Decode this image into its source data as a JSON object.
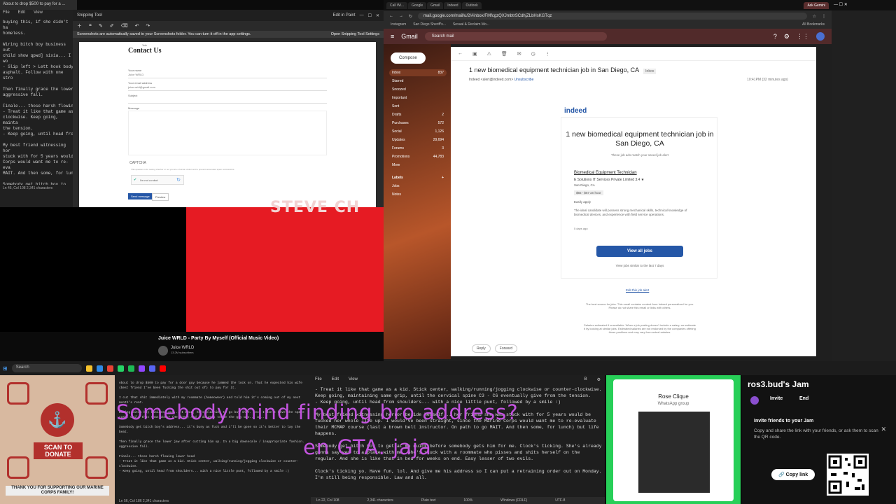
{
  "left_notepad": {
    "title": "About to drop $500 to pay for a ...",
    "menu": [
      "File",
      "Edit",
      "View"
    ],
    "text": "buying this, if she didn't ha\nhomeless.\n\nWiring bitch boy business out\nchild show qpwd] sixia... I wo\n- Slip left > Lett hook body\nasphalt. Follow with one stro\n\nThen finally grace the lower\naggressive fall.\n\nFinale... those harsh flowin\n- Treat it like that game as\nclockwise. Keep going, mainta\nthe tension.\n- Keep going, until head fro\n\nMy best friend witnessing hor\nstuck with for 5 years would\nCorps would want me to re-eva\nMAIT. And then some, for lun\n\nSomebody get bitch boy to let\nShe's already gonna say yes t\nherself on the regular. And s\n\nClock's ticking yo. Have fun\nMonday. I'm still being respo",
    "status": "Ln 45, Col 108    2,341 characters"
  },
  "snip": {
    "title": "Snipping Tool",
    "notif": "Screenshots are automatically saved to your Screenshots folder. You can turn it off in the app settings.",
    "notif_link": "Open Snipping Tool Settings",
    "edit_in_paint": "Edit in Paint",
    "form": {
      "heading": "Contact Us",
      "small_top": "Yob",
      "name_label": "Your name",
      "name_value": "Juice WRLD",
      "email_label": "Your email address",
      "email_value": "juice.wrld@gmail.com",
      "subject_label": "Subject",
      "message_label": "Message",
      "captcha": "CAPTCHA",
      "captcha_text": "This question is for testing whether or not you are a human visitor and to prevent automated spam submissions.",
      "robot": "I'm not a robot",
      "send": "Send message",
      "preview": "Preview"
    }
  },
  "video": {
    "overlay_text": "STEVE CH",
    "title": "Juice WRLD - Party By Myself (Official Music Video)",
    "channel": "Juice WRLD",
    "subs": "13.2M subscribers"
  },
  "chrome": {
    "tabs": [
      "Call Wi...",
      "Google",
      "Gmail",
      "Indeed",
      "Outlook",
      "Ask Gemini"
    ],
    "url": "mail.google.com/mail/u/2/#inbox/FMfcgzQXJmbtrSCdhjZLbHsKGTqz",
    "bookmarks": [
      "Instagram",
      "San Diego Sheriff's...",
      "Sexual & Reclaim Mo..."
    ],
    "all_bookmarks": "All Bookmarks"
  },
  "gmail": {
    "logo": "Gmail",
    "search": "Search mail",
    "compose": "Compose",
    "nav": [
      {
        "label": "Inbox",
        "count": "837"
      },
      {
        "label": "Starred",
        "count": ""
      },
      {
        "label": "Snoozed",
        "count": ""
      },
      {
        "label": "Important",
        "count": ""
      },
      {
        "label": "Sent",
        "count": ""
      },
      {
        "label": "Drafts",
        "count": "2"
      },
      {
        "label": "Purchases",
        "count": "572"
      },
      {
        "label": "Social",
        "count": "1,126"
      },
      {
        "label": "Updates",
        "count": "29,694"
      },
      {
        "label": "Forums",
        "count": "3"
      },
      {
        "label": "Promotions",
        "count": "44,783"
      },
      {
        "label": "More",
        "count": ""
      }
    ],
    "labels_title": "Labels",
    "labels": [
      "Jobs",
      "Notes"
    ],
    "subject": "1 new biomedical equipment technician job in San Diego, CA",
    "inbox_tag": "Inbox",
    "sender": "Indeed <alert@indeed.com>",
    "unsubscribe": "Unsubscribe",
    "time": "10:41PM (32 minutes ago)",
    "email": {
      "brand": "indeed",
      "heading": "1 new biomedical equipment technician job in San Diego, CA",
      "sub": "These job ads match your saved job alert",
      "job_title": "Biomedical Equipment Technician",
      "company": "E Solutions IT Services Private Limited",
      "rating": "3.4 ★",
      "location": "San Diego, CA",
      "pay": "$55 - $57 an hour",
      "easy": "Easily apply",
      "desc": "The ideal candidate will possess strong mechanical skills, technical knowledge of biomedical devices, and experience with field service operations.",
      "age": "5 days ago",
      "view_all": "View all jobs",
      "view_similar": "View jobs similar to the last 7 days",
      "unsub": "Edit this job alert",
      "foot1": "The best source for jobs. This email contains content from Indeed personalized for you. Please do not share this email or links with others.",
      "foot2": "Salaries estimated if unavailable. When a job posting doesn't include a salary, we estimate it by looking at similar jobs. Estimated salaries are not endorsed by the companies offering those positions and may vary from actual salaries."
    },
    "reply": "Reply",
    "forward": "Forward"
  },
  "taskbar": {
    "search": "Search"
  },
  "donate": {
    "scan": "SCAN TO DONATE",
    "thanks": "THANK YOU FOR SUPPORTING OUR MARINE CORPS FAMILY!"
  },
  "bottom_notepad": {
    "text": "About to drop $500 to pay for a door guy because he jammed the lock on. That he expected his wife (best friend I've been fucking the shit out of) to pay for it.\n\nI cut that shit immediately with my roommate (homeowner) and told him it's coming out of my next month's rent.\n\nWiring bitch boy business out... I mean, he's planning to go buy shit. (ex) I don't have the spare cash. Child that that does? (He does) And I do want to be the guy who... uh...\n\nSomebody get bitch boy's address... it's busy as fuck and I'll be gone so it's better to lay the beat.\n\nThen finally grace the lower jaw after cutting him up. In a big downscale / inappropriate fashion. Aggressive fall.\n\nFinale... those harsh flowing lower head\n- Treat it like that game as a kid. Stick center, walking/running/jogging clockwise or counter-clockwise.\n- Keep going, until head from shoulders... with a nice little punt, followed by a smile :)",
    "status": "Ln 56, Col 186    2,341 characters"
  },
  "overlay": {
    "line1": "Somebody mind finding bro address?",
    "line2": "en GTA. jaja"
  },
  "mid_notepad": {
    "menu": [
      "File",
      "Edit",
      "View"
    ],
    "text": "- Treat it like that game as a kid. Stick center, walking/running/jogging clockwise or counter-clockwise. Keep going, maintaining same grip, until the cervical spine C3 - C6 eventually give from the tension.\n- Keep going, until head from shoulders... with a nice little punt, followed by a smile :)\n\nMy best friend witnessing horror beside herself... her friend she was stuck with for 5 years would be fucked her whole life up. I would've been straight, since the Marine Corps would want me to re-evaluate their MCMAP course (last a brown belt instructor. On path to go MAIT. And then some, for lunch) but life happens.\n\nSomebody get bitch boy to get at me quick before somebody gets him for me. Clock's ticking. She's already gonna say yes to a place with me. She's stuck with a roommate who pisses and shits herself on the regular. And she is like that in bed for weeks on end. Easy lesser of two evils.\n\nClock's ticking yo. Have fun, lol. And give me his address so I can put a retraining order out on Monday. I'm still being responsible. Law and all.",
    "status": [
      "Ln 22, Col 108",
      "2,341 characters",
      "Plain text",
      "100%",
      "Windows (CRLF)",
      "UTF-8"
    ]
  },
  "whatsapp": {
    "group": "Rose Clique",
    "sub": "WhatsApp group"
  },
  "jam": {
    "title": "ros3.bud's Jam",
    "invite": "Invite",
    "end": "End",
    "invite_title": "Invite friends to your Jam",
    "invite_desc": "Copy and share the link with your friends, or ask them to scan the QR code.",
    "copy": "Copy link"
  }
}
